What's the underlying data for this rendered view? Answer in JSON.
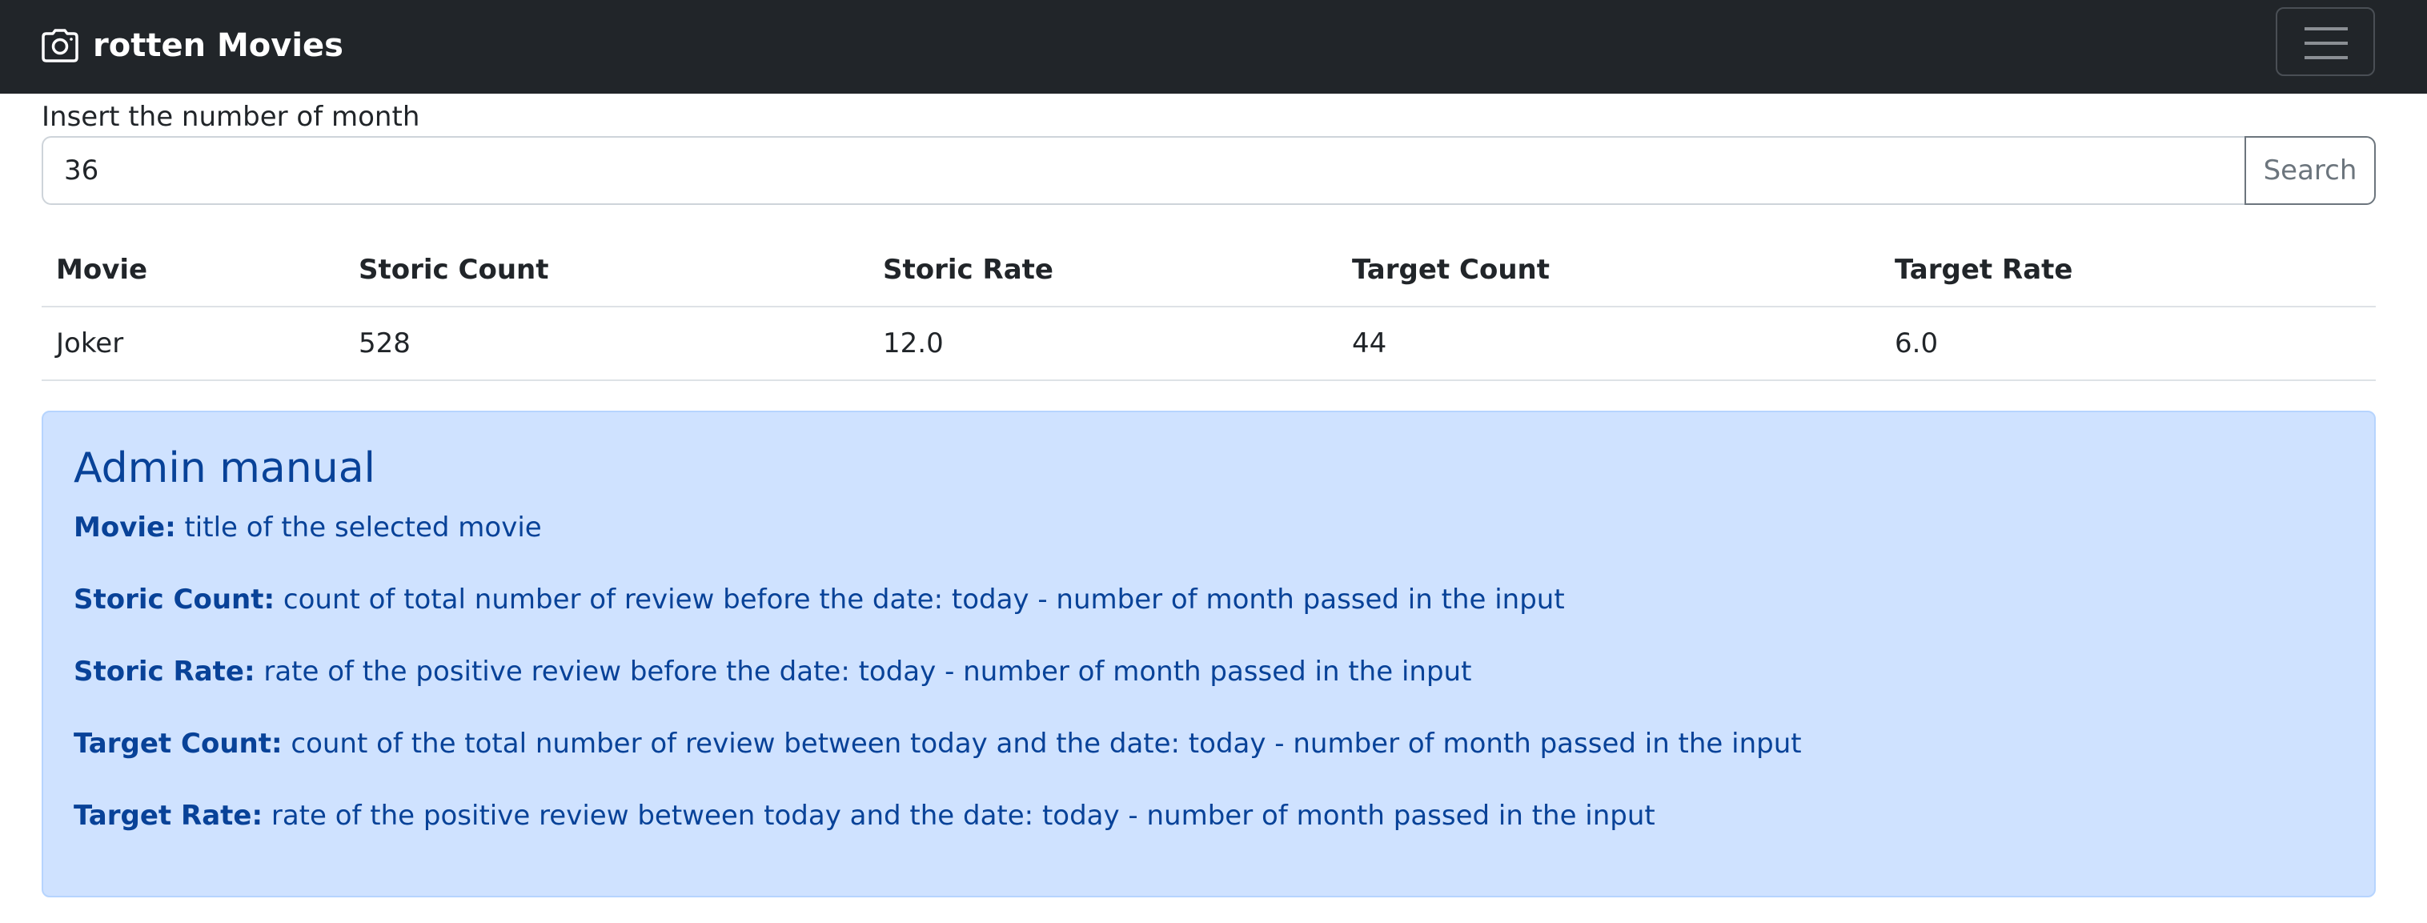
{
  "navbar": {
    "brand": "rotten Movies",
    "brand_icon": "camera-icon",
    "toggler_icon": "hamburger-menu-icon"
  },
  "search": {
    "label": "Insert the number of month",
    "value": "36",
    "button_label": "Search"
  },
  "table": {
    "headers": [
      "Movie",
      "Storic Count",
      "Storic Rate",
      "Target Count",
      "Target Rate"
    ],
    "rows": [
      [
        "Joker",
        "528",
        "12.0",
        "44",
        "6.0"
      ]
    ]
  },
  "manual": {
    "title": "Admin manual",
    "items": [
      {
        "term": "Movie:",
        "desc": " title of the selected movie"
      },
      {
        "term": "Storic Count:",
        "desc": " count of total number of review before the date: today - number of month passed in the input"
      },
      {
        "term": "Storic Rate:",
        "desc": " rate of the positive review before the date: today - number of month passed in the input"
      },
      {
        "term": "Target Count:",
        "desc": " count of the total number of review between today and the date: today - number of month passed in the input"
      },
      {
        "term": "Target Rate:",
        "desc": " rate of the positive review between today and the date: today - number of month passed in the input"
      }
    ]
  },
  "colors": {
    "navbar_bg": "#212529",
    "alert_bg": "#cfe2ff",
    "alert_text": "#084298"
  }
}
